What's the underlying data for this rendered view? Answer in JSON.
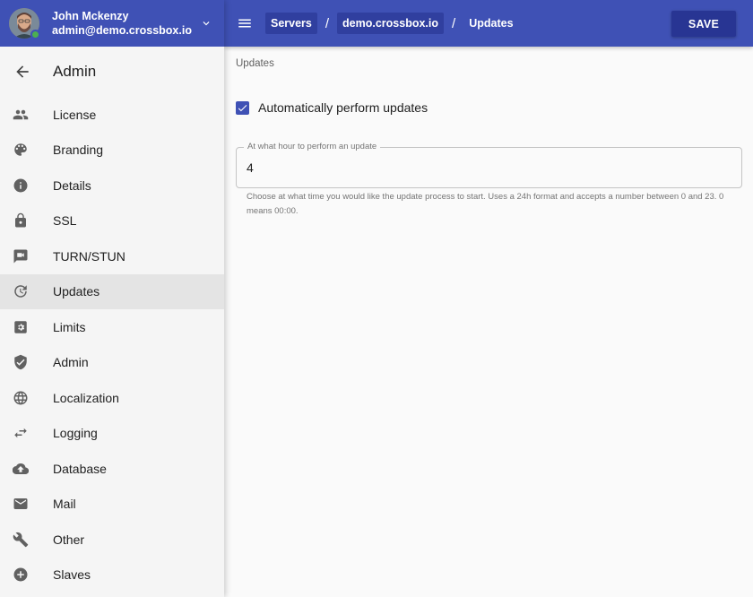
{
  "user": {
    "name": "John Mckenzy",
    "email": "admin@demo.crossbox.io"
  },
  "sidebar": {
    "title": "Admin",
    "items": [
      {
        "label": "License",
        "icon": "people-icon"
      },
      {
        "label": "Branding",
        "icon": "palette-icon"
      },
      {
        "label": "Details",
        "icon": "info-icon"
      },
      {
        "label": "SSL",
        "icon": "lock-icon"
      },
      {
        "label": "TURN/STUN",
        "icon": "video-chat-icon"
      },
      {
        "label": "Updates",
        "icon": "update-icon",
        "active": true
      },
      {
        "label": "Limits",
        "icon": "settings-box-icon"
      },
      {
        "label": "Admin",
        "icon": "shield-check-icon"
      },
      {
        "label": "Localization",
        "icon": "globe-icon"
      },
      {
        "label": "Logging",
        "icon": "swap-horiz-icon"
      },
      {
        "label": "Database",
        "icon": "cloud-upload-icon"
      },
      {
        "label": "Mail",
        "icon": "mail-icon"
      },
      {
        "label": "Other",
        "icon": "wrench-icon"
      },
      {
        "label": "Slaves",
        "icon": "add-circle-icon"
      }
    ]
  },
  "topbar": {
    "breadcrumbs": [
      "Servers",
      "demo.crossbox.io",
      "Updates"
    ],
    "save_label": "SAVE"
  },
  "main": {
    "title": "Updates",
    "auto_update": {
      "label": "Automatically perform updates",
      "checked": true
    },
    "hour_field": {
      "label": "At what hour to perform an update",
      "value": "4",
      "helper": "Choose at what time you would like the update process to start. Uses a 24h format and accepts a number between 0 and 23. 0 means 00:00."
    }
  },
  "colors": {
    "primary": "#3f51b5",
    "primary_dark": "#283593",
    "crumb_bg": "#303f9f",
    "online": "#4caf50"
  }
}
